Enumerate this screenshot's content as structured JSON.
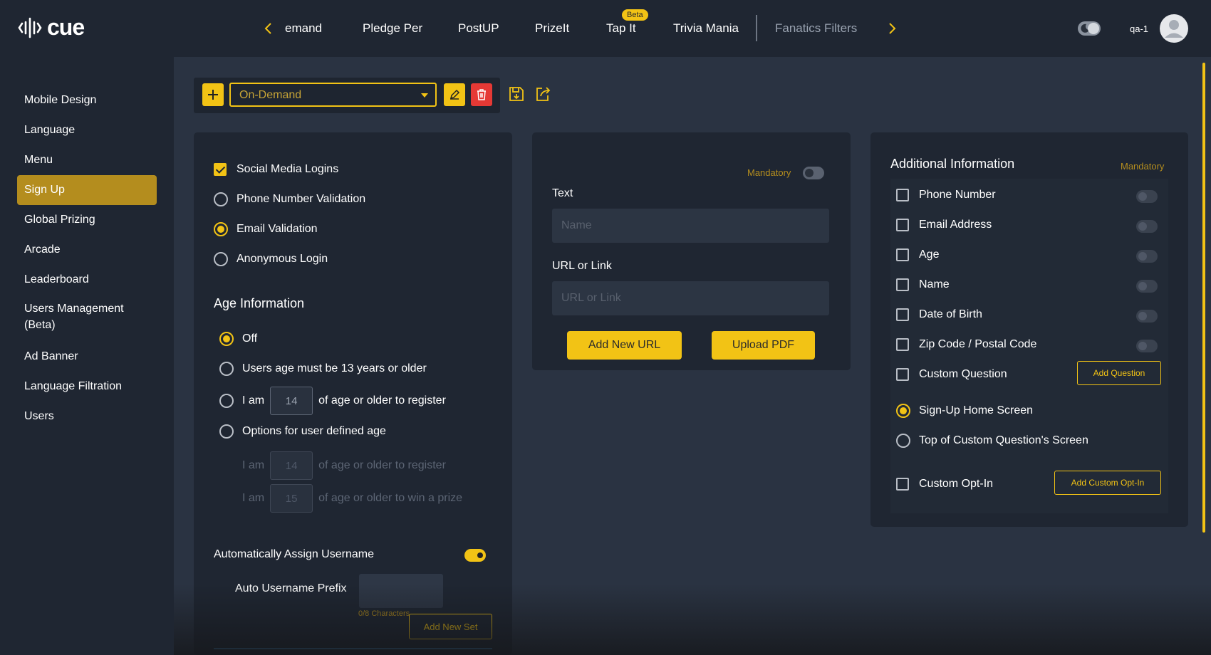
{
  "app": {
    "logo_text": "cue",
    "user": "qa-1"
  },
  "nav": {
    "tabs": [
      {
        "label": "emand"
      },
      {
        "label": "Pledge Per"
      },
      {
        "label": "PostUP"
      },
      {
        "label": "PrizeIt"
      },
      {
        "label": "Tap It",
        "badge": "Beta"
      },
      {
        "label": "Trivia Mania"
      },
      {
        "label": "Fanatics Filters"
      }
    ]
  },
  "sidebar": {
    "items": [
      {
        "label": "Mobile Design"
      },
      {
        "label": "Language"
      },
      {
        "label": "Menu"
      },
      {
        "label": "Sign Up",
        "active": true
      },
      {
        "label": "Global Prizing"
      },
      {
        "label": "Arcade"
      },
      {
        "label": "Leaderboard"
      },
      {
        "label": "Users Management (Beta)"
      },
      {
        "label": "Ad Banner"
      },
      {
        "label": "Language Filtration"
      },
      {
        "label": "Users"
      }
    ]
  },
  "toolbar": {
    "selected": "On-Demand"
  },
  "login": {
    "options": [
      {
        "label": "Social Media Logins",
        "type": "checkbox",
        "checked": true
      },
      {
        "label": "Phone Number Validation",
        "type": "radio",
        "checked": false
      },
      {
        "label": "Email Validation",
        "type": "radio",
        "checked": true
      },
      {
        "label": "Anonymous Login",
        "type": "radio",
        "checked": false
      }
    ]
  },
  "age": {
    "title": "Age Information",
    "off": "Off",
    "must13": "Users age must be 13 years or older",
    "i_am": "I am",
    "age_value": "14",
    "age_suffix": "of age or older to register",
    "options_label": "Options for user defined age",
    "register_value": "14",
    "register_suffix": "of age or older to register",
    "prize_value": "15",
    "prize_suffix": "of age or older to win a prize"
  },
  "username": {
    "auto_label": "Automatically Assign Username",
    "prefix_label": "Auto Username Prefix",
    "char_count": "0/8 Characters",
    "add_set": "Add New Set"
  },
  "links": {
    "mandatory": "Mandatory",
    "text_label": "Text",
    "text_placeholder": "Name",
    "url_label": "URL or Link",
    "url_placeholder": "URL or Link",
    "add_url": "Add New URL",
    "upload_pdf": "Upload PDF"
  },
  "additional": {
    "title": "Additional Information",
    "mandatory": "Mandatory",
    "fields": [
      {
        "label": "Phone Number"
      },
      {
        "label": "Email Address"
      },
      {
        "label": "Age"
      },
      {
        "label": "Name"
      },
      {
        "label": "Date of Birth"
      },
      {
        "label": "Zip Code / Postal Code"
      }
    ],
    "custom_question": "Custom Question",
    "add_question": "Add Question",
    "home_screen": "Sign-Up Home Screen",
    "top_custom": "Top of Custom Question's Screen",
    "custom_optin": "Custom Opt-In",
    "add_optin": "Add Custom Opt-In"
  },
  "colors": {
    "accent": "#f2c315",
    "danger": "#e53935",
    "panel": "#1f2632",
    "background": "#2a3342"
  }
}
